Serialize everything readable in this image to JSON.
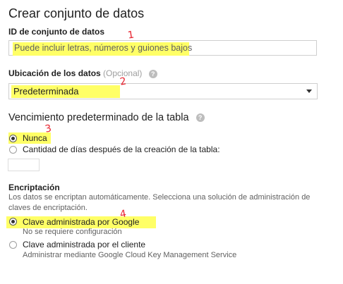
{
  "dialog": {
    "title": "Crear conjunto de datos"
  },
  "dataset_id": {
    "label": "ID de conjunto de datos",
    "placeholder": "Puede incluir letras, números y guiones bajos"
  },
  "location": {
    "label": "Ubicación de los datos",
    "optional": "(Opcional)",
    "selected": "Predeterminada"
  },
  "expiration": {
    "title": "Vencimiento predeterminado de la tabla",
    "options": [
      {
        "label": "Nunca",
        "checked": true
      },
      {
        "label": "Cantidad de días después de la creación de la tabla:",
        "checked": false
      }
    ]
  },
  "encryption": {
    "title": "Encriptación",
    "description_lines": [
      "Los datos se encriptan automáticamente. Selecciona una solución de administración de",
      "claves de encriptación."
    ],
    "options": [
      {
        "label": "Clave administrada por Google",
        "sub": "No se requiere configuración",
        "checked": true
      },
      {
        "label": "Clave administrada por el cliente",
        "sub": "Administrar mediante Google Cloud Key Management Service",
        "checked": false
      }
    ]
  },
  "annotations": {
    "mark1": "1",
    "mark2": "2",
    "mark3": "3",
    "mark4": "4"
  },
  "icons": {
    "help": "help-circle-icon",
    "dropdown": "caret-down-icon"
  },
  "colors": {
    "highlight": "#ffff66",
    "annotation": "#e8232f"
  }
}
